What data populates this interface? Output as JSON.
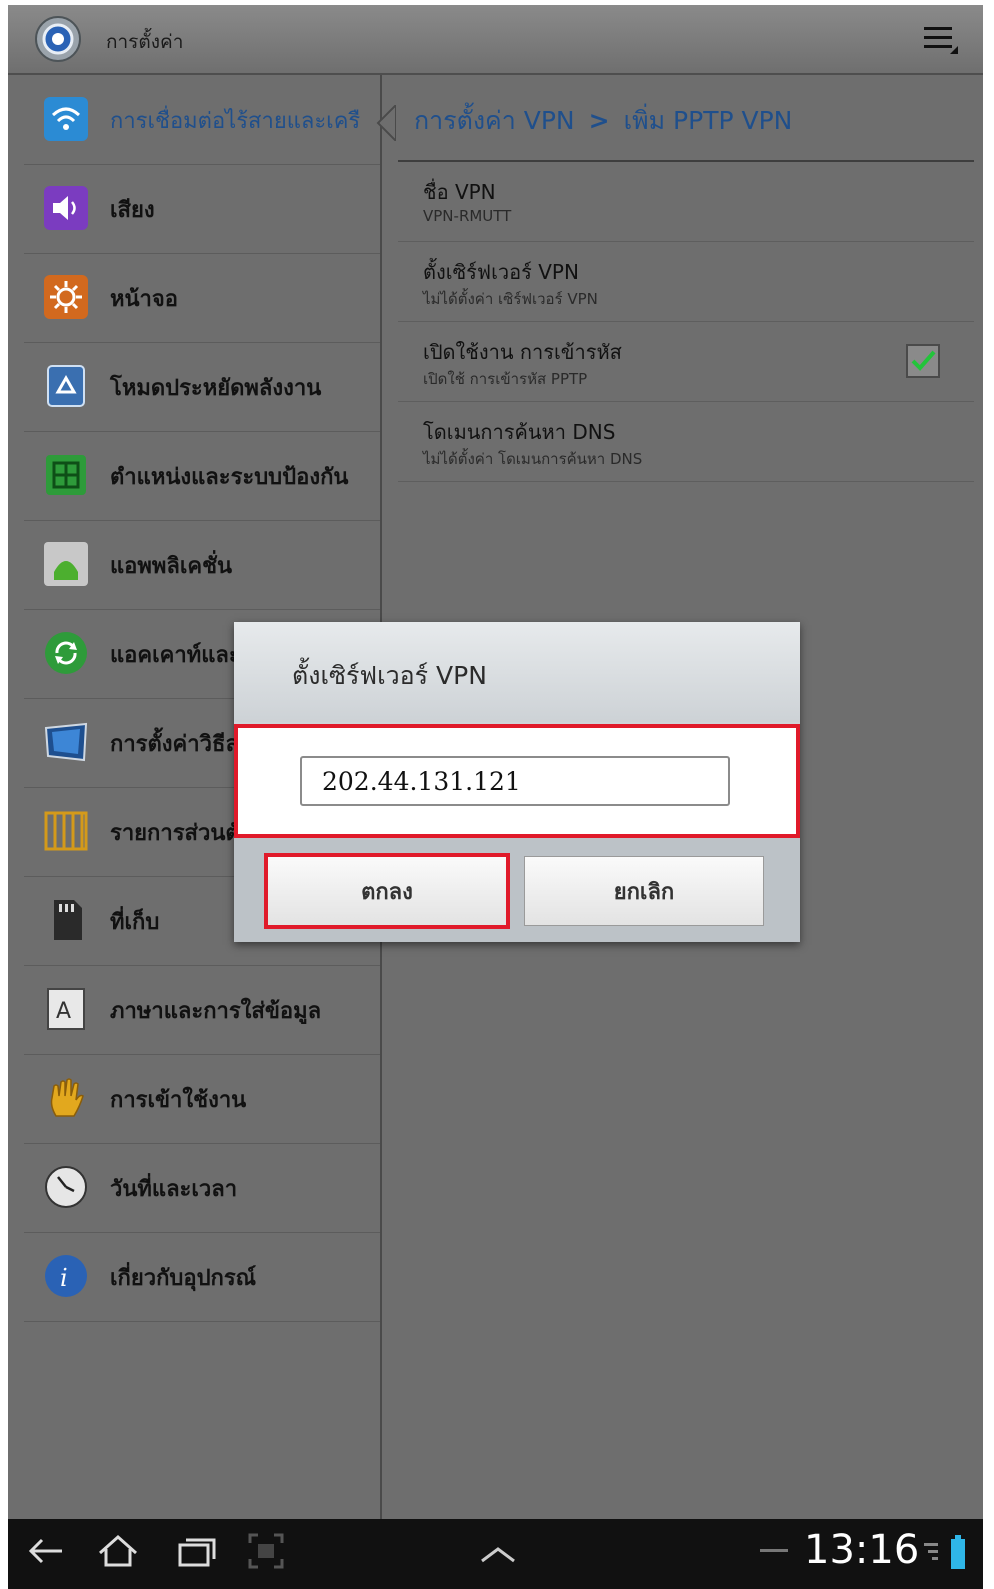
{
  "actionbar": {
    "title": "การตั้งค่า"
  },
  "sidebar": {
    "items": [
      {
        "label": "การเชื่อมต่อไร้สายและเครือข่าย",
        "icon": "wifi-icon",
        "selected": true
      },
      {
        "label": "เสียง",
        "icon": "sound-icon"
      },
      {
        "label": "หน้าจอ",
        "icon": "display-icon"
      },
      {
        "label": "โหมดประหยัดพลังงาน",
        "icon": "power-saving-icon"
      },
      {
        "label": "ตำแหน่งและระบบป้องกัน",
        "icon": "location-security-icon"
      },
      {
        "label": "แอพพลิเคชั่น",
        "icon": "android-icon"
      },
      {
        "label": "แอคเคาท์และ",
        "icon": "sync-icon"
      },
      {
        "label": "การตั้งค่าวิธีล",
        "icon": "motion-icon"
      },
      {
        "label": "รายการส่วนตั",
        "icon": "privacy-icon"
      },
      {
        "label": "ที่เก็บ",
        "icon": "sdcard-icon"
      },
      {
        "label": "ภาษาและการใส่ข้อมูล",
        "icon": "language-icon"
      },
      {
        "label": "การเข้าใช้งาน",
        "icon": "hand-icon"
      },
      {
        "label": "วันที่และเวลา",
        "icon": "clock-icon"
      },
      {
        "label": "เกี่ยวกับอุปกรณ์",
        "icon": "info-icon"
      }
    ]
  },
  "breadcrumb": {
    "parent": "การตั้งค่า VPN",
    "separator": ">",
    "current": "เพิ่ม PPTP VPN"
  },
  "preferences": [
    {
      "title": "ชื่อ VPN",
      "summary": "VPN-RMUTT"
    },
    {
      "title": "ตั้งเซิร์ฟเวอร์ VPN",
      "summary": "ไม่ได้ตั้งค่า เซิร์ฟเวอร์ VPN"
    },
    {
      "title": "เปิดใช้งาน การเข้ารหัส",
      "summary": "เปิดใช้ การเข้ารหัส PPTP",
      "checked": true
    },
    {
      "title": "โดเมนการค้นหา DNS",
      "summary": "ไม่ได้ตั้งค่า โดเมนการค้นหา DNS"
    }
  ],
  "dialog": {
    "title": "ตั้งเซิร์ฟเวอร์ VPN",
    "input_value": "202.44.131.121",
    "ok_label": "ตกลง",
    "cancel_label": "ยกเลิก"
  },
  "statusbar": {
    "time": "13:16"
  },
  "colors": {
    "accent": "#1f4f8c",
    "highlight": "#e01a2a"
  }
}
